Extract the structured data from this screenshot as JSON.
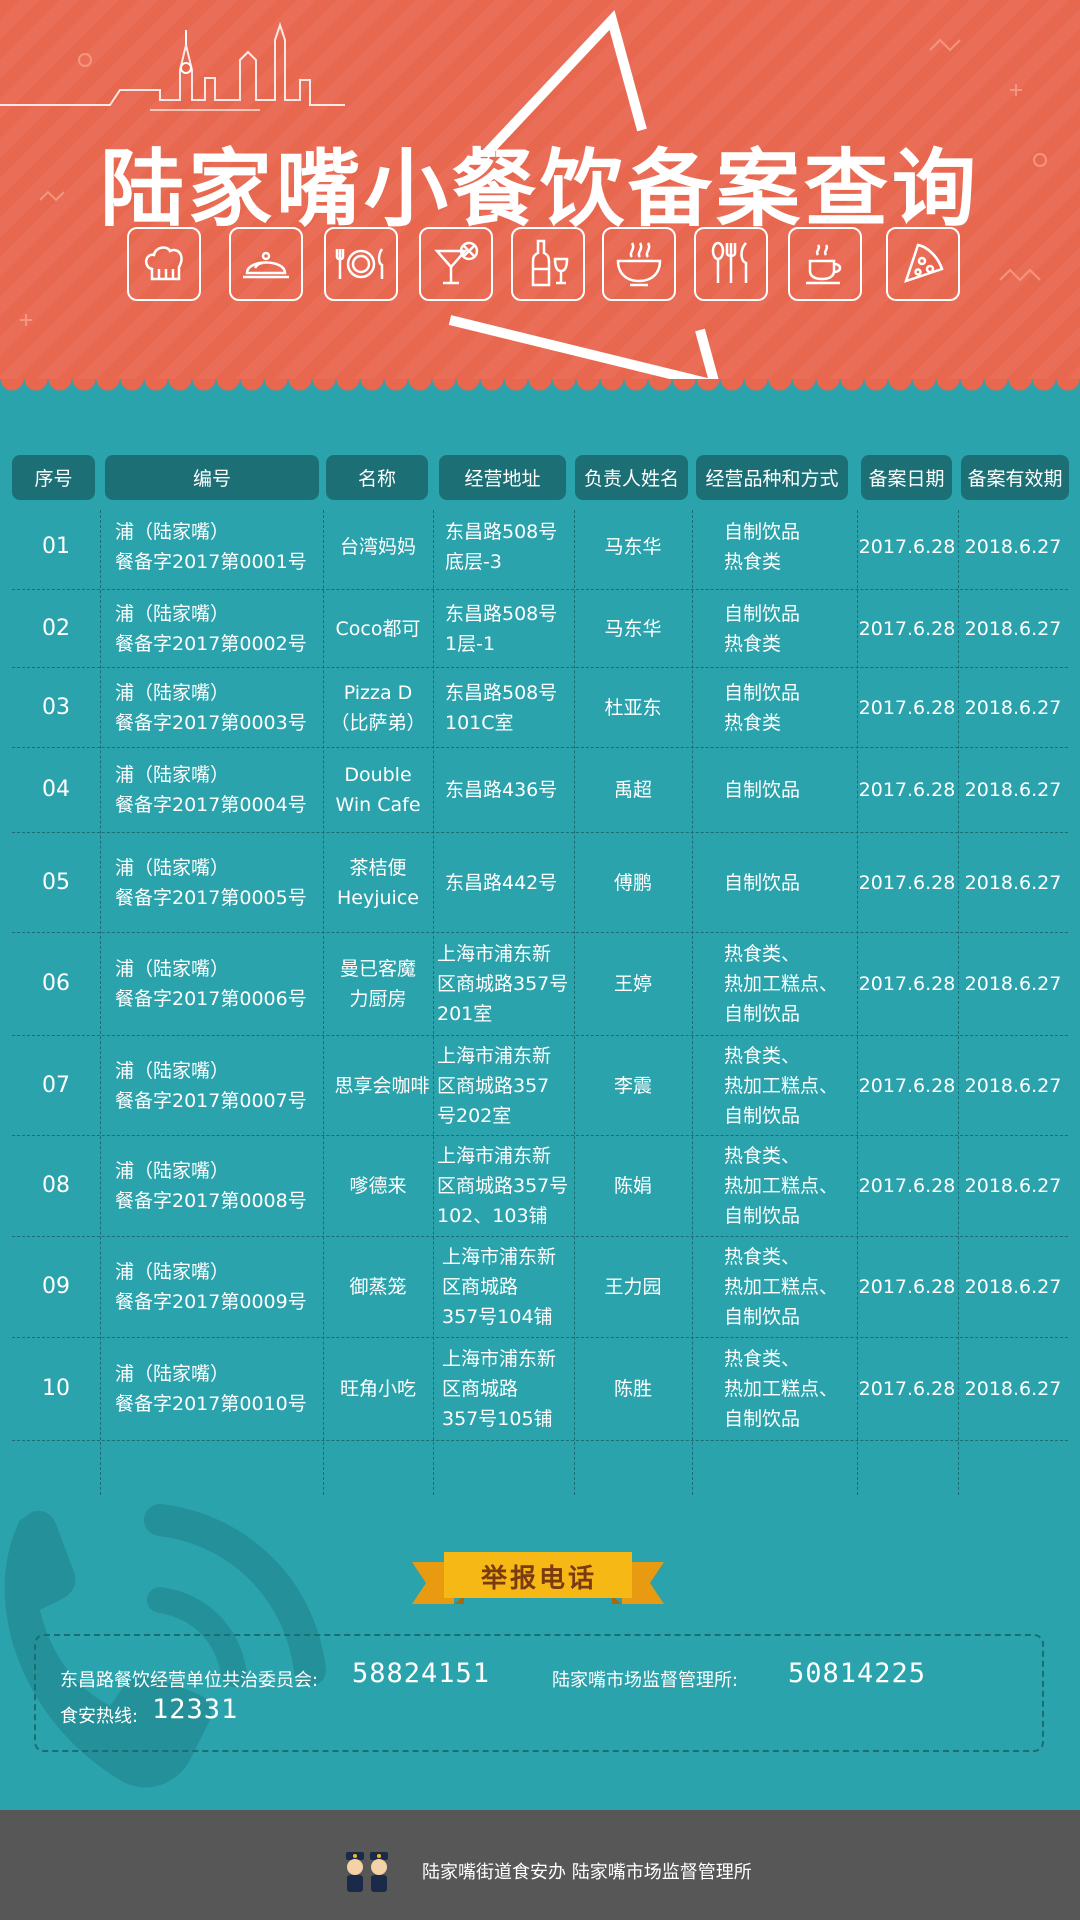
{
  "title": "陆家嘴小餐饮备案查询",
  "icons": [
    "chef-hat-icon",
    "cloche-icon",
    "plate-cutlery-icon",
    "cocktail-icon",
    "wine-icon",
    "soup-bowl-icon",
    "spoon-fork-knife-icon",
    "coffee-cup-icon",
    "pizza-slice-icon"
  ],
  "table": {
    "headers": [
      "序号",
      "编号",
      "名称",
      "经营地址",
      "负责人姓名",
      "经营品种和方式",
      "备案日期",
      "备案有效期"
    ],
    "rows": [
      {
        "seq": "01",
        "code": "浦（陆家嘴）\n餐备字2017第0001号",
        "name": "台湾妈妈",
        "addr": "东昌路508号\n底层-3",
        "person": "马东华",
        "type": "自制饮品\n热食类",
        "date": "2017.6.28",
        "valid": "2018.6.27"
      },
      {
        "seq": "02",
        "code": "浦（陆家嘴）\n餐备字2017第0002号",
        "name": "Coco都可",
        "addr": "东昌路508号\n1层-1",
        "person": "马东华",
        "type": "自制饮品\n热食类",
        "date": "2017.6.28",
        "valid": "2018.6.27"
      },
      {
        "seq": "03",
        "code": "浦（陆家嘴）\n餐备字2017第0003号",
        "name": "Pizza D\n（比萨弟）",
        "addr": "东昌路508号\n101C室",
        "person": "杜亚东",
        "type": "自制饮品\n热食类",
        "date": "2017.6.28",
        "valid": "2018.6.27"
      },
      {
        "seq": "04",
        "code": "浦（陆家嘴）\n餐备字2017第0004号",
        "name": "Double\nWin Cafe",
        "addr": "东昌路436号",
        "person": "禹超",
        "type": "自制饮品",
        "date": "2017.6.28",
        "valid": "2018.6.27"
      },
      {
        "seq": "05",
        "code": "浦（陆家嘴）\n餐备字2017第0005号",
        "name": "茶桔便\nHeyjuice",
        "addr": "东昌路442号",
        "person": "傅鹏",
        "type": "自制饮品",
        "date": "2017.6.28",
        "valid": "2018.6.27"
      },
      {
        "seq": "06",
        "code": "浦（陆家嘴）\n餐备字2017第0006号",
        "name": "曼已客魔\n力厨房",
        "addr": "上海市浦东新\n区商城路357号\n201室",
        "person": "王婷",
        "type": "热食类、\n热加工糕点、\n自制饮品",
        "date": "2017.6.28",
        "valid": "2018.6.27"
      },
      {
        "seq": "07",
        "code": "浦（陆家嘴）\n餐备字2017第0007号",
        "name": "思享会咖啡",
        "addr": "上海市浦东新\n区商城路357\n号202室",
        "person": "李震",
        "type": "热食类、\n热加工糕点、\n自制饮品",
        "date": "2017.6.28",
        "valid": "2018.6.27"
      },
      {
        "seq": "08",
        "code": "浦（陆家嘴）\n餐备字2017第0008号",
        "name": "嗲德来",
        "addr": "上海市浦东新\n区商城路357号\n102、103铺",
        "person": "陈娟",
        "type": "热食类、\n热加工糕点、\n自制饮品",
        "date": "2017.6.28",
        "valid": "2018.6.27"
      },
      {
        "seq": "09",
        "code": "浦（陆家嘴）\n餐备字2017第0009号",
        "name": "御蒸笼",
        "addr": "上海市浦东新\n区商城路\n357号104铺",
        "person": "王力园",
        "type": "热食类、\n热加工糕点、\n自制饮品",
        "date": "2017.6.28",
        "valid": "2018.6.27"
      },
      {
        "seq": "10",
        "code": "浦（陆家嘴）\n餐备字2017第0010号",
        "name": "旺角小吃",
        "addr": "上海市浦东新\n区商城路\n357号105铺",
        "person": "陈胜",
        "type": "热食类、\n热加工糕点、\n自制饮品",
        "date": "2017.6.28",
        "valid": "2018.6.27"
      }
    ]
  },
  "report": {
    "title": "举报电话",
    "contact1_label": "东昌路餐饮经营单位共治委员会:",
    "contact1_number": "58824151",
    "contact2_label": "陆家嘴市场监督管理所:",
    "contact2_number": "50814225",
    "contact3_label": "食安热线:",
    "contact3_number": "12331"
  },
  "footer": {
    "text": "陆家嘴街道食安办  陆家嘴市场监督管理所"
  },
  "colors": {
    "header": "#e8674f",
    "body": "#2aa3ac",
    "table_header": "#1c6f75",
    "ribbon": "#f6b814",
    "footer": "#575757"
  }
}
